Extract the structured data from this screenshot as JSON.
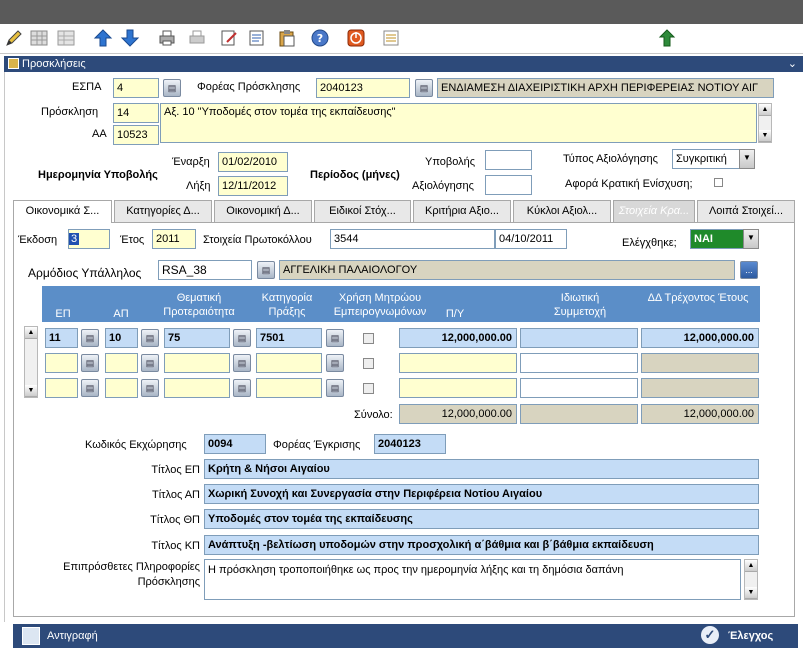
{
  "toolbar": {
    "icons": [
      "pencil-icon",
      "grid-icon",
      "grid-gray-icon",
      "arrow-up-icon",
      "arrow-down-icon",
      "print-icon",
      "print-gray-icon",
      "edit-icon",
      "document-icon",
      "paste-icon",
      "help-icon",
      "stop-icon",
      "list-icon",
      "exit-icon"
    ]
  },
  "window": {
    "title": "Προσκλήσεις",
    "minimize": "⌄"
  },
  "form": {
    "espa_label": "ΕΣΠΑ",
    "espa_value": "4",
    "foreas_label": "Φορέας Πρόσκλησης",
    "foreas_code": "2040123",
    "foreas_name": "ΕΝΔΙΑΜΕΣΗ ΔΙΑΧΕΙΡΙΣΤΙΚΗ ΑΡΧΗ ΠΕΡΙΦΕΡΕΙΑΣ ΝΟΤΙΟΥ ΑΙΓ",
    "prosklisi_label": "Πρόσκληση",
    "prosklisi_value": "14",
    "prosklisi_text": "Αξ. 10 \"Υποδομές στον τομέα της εκπαίδευσης\"",
    "aa_label": "ΑΑ",
    "aa_value": "10523",
    "enarxi_label": "Έναρξη",
    "enarxi_value": "01/02/2010",
    "lixi_label": "Λήξη",
    "lixi_value": "12/11/2012",
    "imerominia_label": "Ημερομηνία Υποβολής",
    "periodos_label": "Περίοδος (μήνες)",
    "ypovolis_label": "Υποβολής",
    "ypovolis_value": "",
    "axiologisis_label": "Αξιολόγησης",
    "axiologisis_value": "",
    "typos_label": "Τύπος Αξιολόγησης",
    "typos_value": "Συγκριτική",
    "afora_label": "Αφορά Κρατική  Ενίσχυση;"
  },
  "tabs": [
    "Οικονομικά Σ...",
    "Κατηγορίες Δ...",
    "Οικονομική Δ...",
    "Ειδικοί Στόχ...",
    "Κριτήρια Αξιο...",
    "Κύκλοι Αξιολ...",
    "Στοιχεία Κρα...",
    "Λοιπά Στοιχεί..."
  ],
  "panel": {
    "ekdosi_label": "Έκδοση",
    "ekdosi_value": "3",
    "etos_label": "Έτος",
    "etos_value": "2011",
    "protokollo_label": "Στοιχεία Πρωτοκόλλου",
    "protokollo_value": "3544",
    "protokollo_date": "04/10/2011",
    "elegxthike_label": "Ελέγχθηκε;",
    "elegxthike_value": "ΝΑΙ",
    "ypallilos_label": "Αρμόδιος Υπάλληλος",
    "ypallilos_code": "RSA_38",
    "ypallilos_name": "ΑΓΓΕΛΙΚΗ ΠΑΛΑΙΟΛΟΓΟΥ",
    "ellipsis": "..."
  },
  "grid": {
    "headers": {
      "ep": "ΕΠ",
      "ap": "ΑΠ",
      "thematiki": "Θεματική Προτεραιότητα",
      "katigoria": "Κατηγορία Πράξης",
      "xrisi": "Χρήση Μητρώου Εμπειρογνωμόνων",
      "py": "Π/Υ",
      "idiotiki": "Ιδιωτική Συμμετοχή",
      "dd": "ΔΔ Τρέχοντος Έτους"
    },
    "rows": [
      {
        "ep": "11",
        "ap": "10",
        "thematiki": "75",
        "katigoria": "7501",
        "py": "12,000,000.00",
        "idiotiki": "",
        "dd": "12,000,000.00"
      },
      {
        "ep": "",
        "ap": "",
        "thematiki": "",
        "katigoria": "",
        "py": "",
        "idiotiki": "",
        "dd": ""
      },
      {
        "ep": "",
        "ap": "",
        "thematiki": "",
        "katigoria": "",
        "py": "",
        "idiotiki": "",
        "dd": ""
      }
    ],
    "synolo_label": "Σύνολο:",
    "synolo_py": "12,000,000.00",
    "synolo_idiotiki": "",
    "synolo_dd": "12,000,000.00"
  },
  "details": {
    "kodikos_label": "Κωδικός Εκχώρησης",
    "kodikos_value": "0094",
    "foreas_egkrisis_label": "Φορέας Έγκρισης",
    "foreas_egkrisis_value": "2040123",
    "titlos_ep_label": "Τίτλος ΕΠ",
    "titlos_ep_value": "Κρήτη & Νήσοι Αιγαίου",
    "titlos_ap_label": "Τίτλος ΑΠ",
    "titlos_ap_value": "Χωρική Συνοχή και Συνεργασία στην Περιφέρεια Νοτίου Αιγαίου",
    "titlos_thp_label": "Τίτλος ΘΠ",
    "titlos_thp_value": "Υποδομές στον τομέα της εκπαίδευσης",
    "titlos_kp_label": "Τίτλος ΚΠ",
    "titlos_kp_value": "Ανάπτυξη -βελτίωση υποδομών στην προσχολική α΄βάθμια και β΄βάθμια εκπαίδευση",
    "epiprosthetes_label1": "Επιπρόσθετες Πληροφορίες",
    "epiprosthetes_label2": "Πρόσκλησης",
    "epiprosthetes_value": "Η πρόσκληση τροποποιήθηκε ως προς την ημερομηνία λήξης και τη δημόσια δαπάνη"
  },
  "bottom": {
    "copy_label": "Αντιγραφή",
    "check_label": "Έλεγχος"
  }
}
